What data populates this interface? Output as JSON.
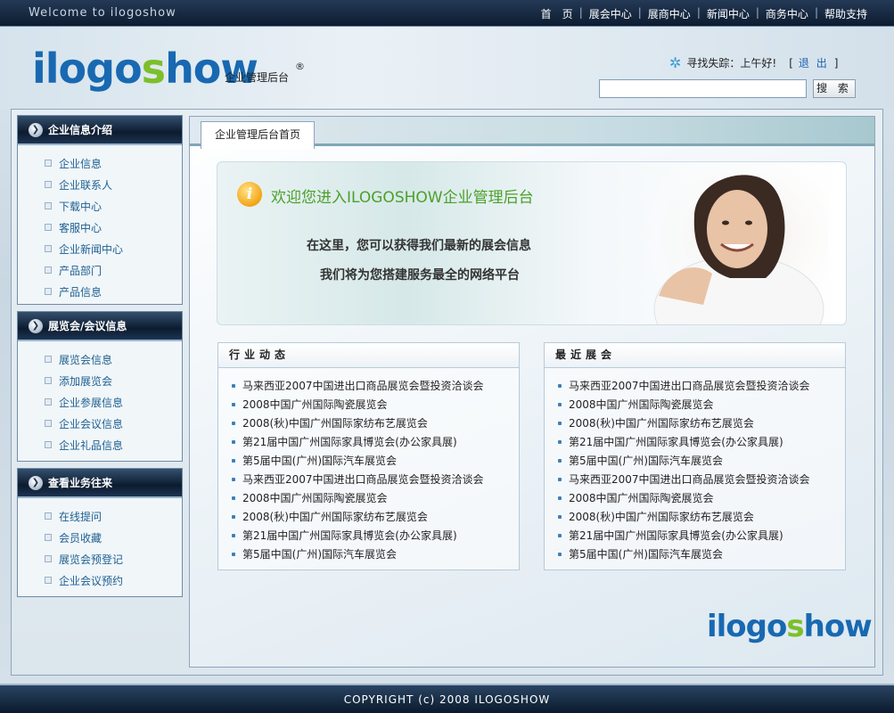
{
  "topbar": {
    "welcome": "Welcome to ilogoshow",
    "nav": [
      "首　页",
      "展会中心",
      "展商中心",
      "新闻中心",
      "商务中心",
      "帮助支持"
    ]
  },
  "header": {
    "logo_part1": "ilogo",
    "logo_part2": "s",
    "logo_part3": "how",
    "subtitle": "企业管理后台",
    "reg": "®",
    "greeting": "寻找失踪：上午好!",
    "logout": "退 出",
    "search_placeholder": "",
    "search_button": "搜 索"
  },
  "panels": [
    {
      "title": "企业信息介绍",
      "items": [
        "企业信息",
        "企业联系人",
        "下载中心",
        "客服中心",
        "企业新闻中心",
        "产品部门",
        "产品信息"
      ]
    },
    {
      "title": "展览会/会议信息",
      "items": [
        "展览会信息",
        "添加展览会",
        "企业参展信息",
        "企业会议信息",
        "企业礼品信息"
      ]
    },
    {
      "title": "查看业务往来",
      "items": [
        "在线提问",
        "会员收藏",
        "展览会预登记",
        "企业会议预约"
      ]
    }
  ],
  "content": {
    "tab": "企业管理后台首页",
    "banner_title": "欢迎您进入ILOGOSHOW企业管理后台",
    "banner_line1": "在这里，您可以获得我们最新的展会信息",
    "banner_line2": "我们将为您搭建服务最全的网络平台",
    "industry": {
      "title": "行业动态",
      "items": [
        "马来西亚2007中国进出口商品展览会暨投资洽谈会",
        "2008中国广州国际陶瓷展览会",
        "2008(秋)中国广州国际家纺布艺展览会",
        "第21届中国广州国际家具博览会(办公家具展)",
        "第5届中国(广州)国际汽车展览会",
        "马来西亚2007中国进出口商品展览会暨投资洽谈会",
        "2008中国广州国际陶瓷展览会",
        "2008(秋)中国广州国际家纺布艺展览会",
        "第21届中国广州国际家具博览会(办公家具展)",
        "第5届中国(广州)国际汽车展览会"
      ]
    },
    "recent": {
      "title": "最近展会",
      "items": [
        "马来西亚2007中国进出口商品展览会暨投资洽谈会",
        "2008中国广州国际陶瓷展览会",
        "2008(秋)中国广州国际家纺布艺展览会",
        "第21届中国广州国际家具博览会(办公家具展)",
        "第5届中国(广州)国际汽车展览会",
        "马来西亚2007中国进出口商品展览会暨投资洽谈会",
        "2008中国广州国际陶瓷展览会",
        "2008(秋)中国广州国际家纺布艺展览会",
        "第21届中国广州国际家具博览会(办公家具展)",
        "第5届中国(广州)国际汽车展览会"
      ]
    }
  },
  "footer": "COPYRIGHT (c) 2008 ILOGOSHOW",
  "colors": {
    "accent": "#1869b1",
    "brand_green": "#7cbf2a",
    "bar_dark": "#0d1c30"
  }
}
